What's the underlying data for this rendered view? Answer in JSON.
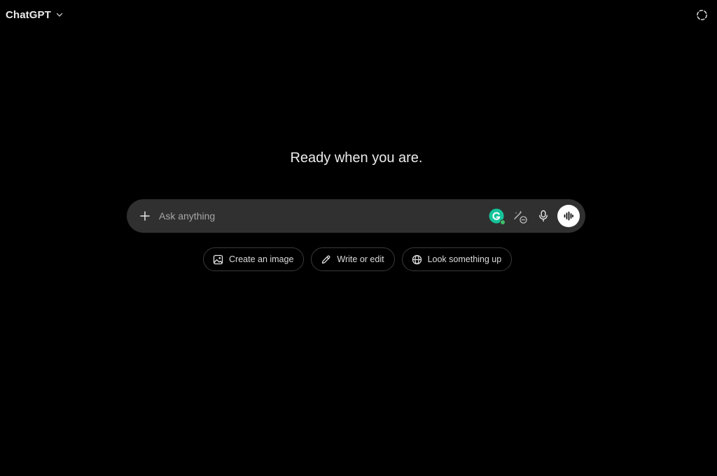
{
  "header": {
    "model_name": "ChatGPT",
    "model_chevron_icon": "chevron-down-icon",
    "temporary_chat_icon": "dashed-circle-icon"
  },
  "main": {
    "headline": "Ready when you are."
  },
  "composer": {
    "placeholder": "Ask anything",
    "value": "",
    "plus_icon": "plus-icon",
    "grammarly_icon": "grammarly-icon",
    "tools_icon": "tools-icon",
    "mic_icon": "microphone-icon",
    "voice_icon": "voice-waveform-icon"
  },
  "suggestions": [
    {
      "label": "Create an image",
      "icon": "image-icon"
    },
    {
      "label": "Write or edit",
      "icon": "pencil-icon"
    },
    {
      "label": "Look something up",
      "icon": "globe-icon"
    }
  ],
  "colors": {
    "background": "#000000",
    "composer_bg": "#303030",
    "text": "#ececec",
    "placeholder": "#a6a6a6",
    "grammarly_green": "#15c39a",
    "status_dot": "#3fbf6a",
    "voice_button": "#ffffff"
  }
}
